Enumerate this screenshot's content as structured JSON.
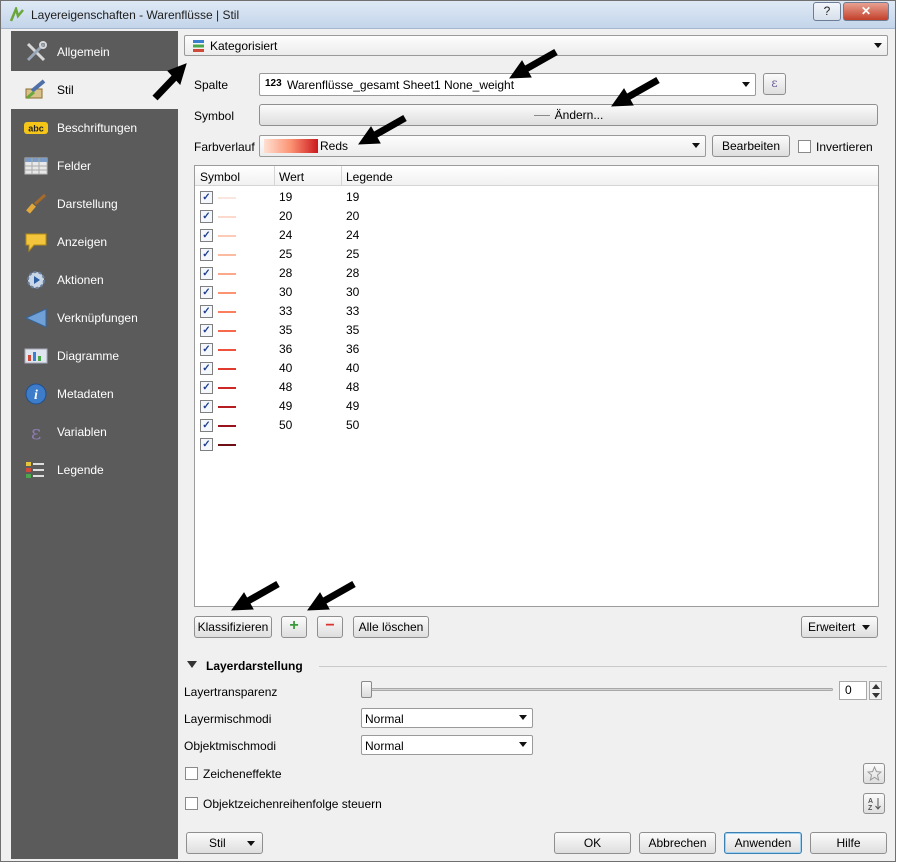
{
  "window": {
    "title": "Layereigenschaften - Warenflüsse | Stil",
    "help_label": "?",
    "close_label": "✕"
  },
  "sidebar": {
    "items": [
      {
        "label": "Allgemein",
        "icon": "tools-icon"
      },
      {
        "label": "Stil",
        "icon": "brush-icon"
      },
      {
        "label": "Beschriftungen",
        "icon": "abc-label-icon"
      },
      {
        "label": "Felder",
        "icon": "table-icon"
      },
      {
        "label": "Darstellung",
        "icon": "paintbrush-icon"
      },
      {
        "label": "Anzeigen",
        "icon": "speech-bubble-icon"
      },
      {
        "label": "Aktionen",
        "icon": "gear-play-icon"
      },
      {
        "label": "Verknüpfungen",
        "icon": "join-icon"
      },
      {
        "label": "Diagramme",
        "icon": "diagram-icon"
      },
      {
        "label": "Metadaten",
        "icon": "info-icon"
      },
      {
        "label": "Variablen",
        "icon": "epsilon-icon"
      },
      {
        "label": "Legende",
        "icon": "legend-icon"
      }
    ],
    "active_index": 1,
    "badge_abc": "abc"
  },
  "renderer": {
    "type_label": "Kategorisiert",
    "column_label": "Spalte",
    "column_type_prefix": "123",
    "column_value": "Warenflüsse_gesamt Sheet1 None_weight",
    "expression_button": "ε",
    "symbol_label": "Symbol",
    "symbol_button": "Ändern...",
    "ramp_label": "Farbverlauf",
    "ramp_value": "Reds",
    "edit_button": "Bearbeiten",
    "invert_label": "Invertieren"
  },
  "table": {
    "headers": {
      "symbol": "Symbol",
      "value": "Wert",
      "legend": "Legende"
    },
    "rows": [
      {
        "value": "19",
        "legend": "19",
        "color": "#fbe6df"
      },
      {
        "value": "20",
        "legend": "20",
        "color": "#fbd9cc"
      },
      {
        "value": "24",
        "legend": "24",
        "color": "#fccbb7"
      },
      {
        "value": "25",
        "legend": "25",
        "color": "#fcbba1"
      },
      {
        "value": "28",
        "legend": "28",
        "color": "#fca98b"
      },
      {
        "value": "30",
        "legend": "30",
        "color": "#fc9474"
      },
      {
        "value": "33",
        "legend": "33",
        "color": "#fb7f5f"
      },
      {
        "value": "35",
        "legend": "35",
        "color": "#f6694d"
      },
      {
        "value": "36",
        "legend": "36",
        "color": "#ee523d"
      },
      {
        "value": "40",
        "legend": "40",
        "color": "#e13b30"
      },
      {
        "value": "48",
        "legend": "48",
        "color": "#cc2826"
      },
      {
        "value": "49",
        "legend": "49",
        "color": "#b51d21"
      },
      {
        "value": "50",
        "legend": "50",
        "color": "#9a131c"
      },
      {
        "value": "",
        "legend": "",
        "color": "#6e0f16"
      }
    ]
  },
  "table_actions": {
    "classify": "Klassifizieren",
    "add_symbol": "+",
    "remove_symbol": "−",
    "delete_all": "Alle löschen",
    "advanced": "Erweitert"
  },
  "layer_rendering": {
    "section_title": "Layerdarstellung",
    "transparency_label": "Layertransparenz",
    "transparency_value": "0",
    "transparency_percent": 0,
    "blend_label": "Layermischmodi",
    "blend_value": "Normal",
    "feature_blend_label": "Objektmischmodi",
    "feature_blend_value": "Normal",
    "effects_label": "Zeicheneffekte",
    "order_label": "Objektzeichenreihenfolge steuern"
  },
  "footer": {
    "style_button": "Stil",
    "ok": "OK",
    "cancel": "Abbrechen",
    "apply": "Anwenden",
    "help": "Hilfe"
  },
  "colors": {
    "sidebar_bg": "#5b5b5b",
    "ramp_start": "#fee0d2",
    "ramp_end": "#cb181d",
    "annotation_arrow": "#000000"
  }
}
